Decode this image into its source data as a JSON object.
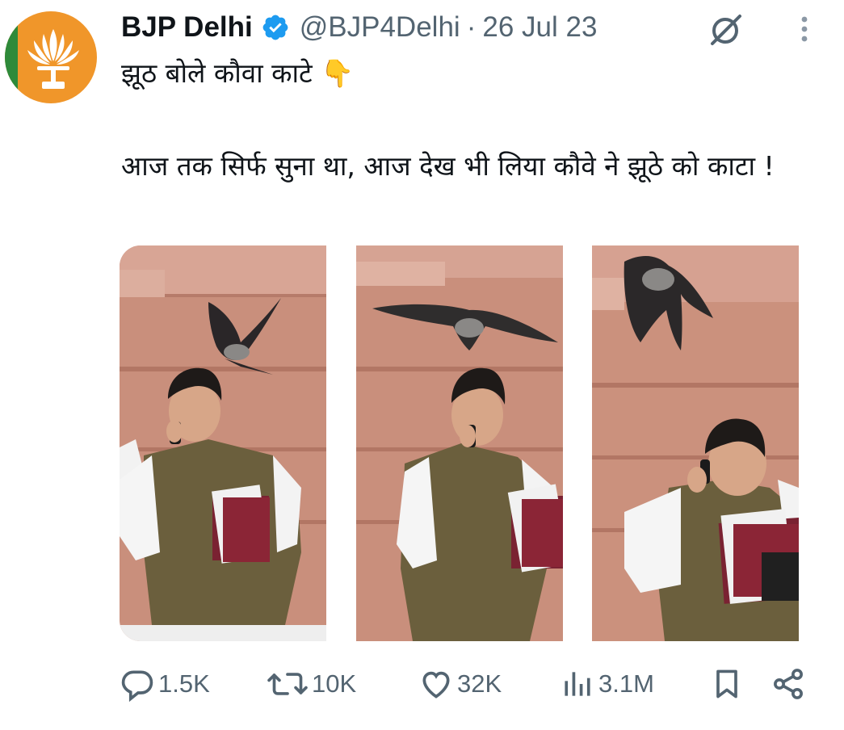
{
  "tweet": {
    "display_name": "BJP Delhi",
    "handle": "@BJP4Delhi",
    "separator": "·",
    "date": "26 Jul 23",
    "text_line1": "झूठ बोले कौवा काटे 👇",
    "text_line2": "आज तक सिर्फ सुना था, आज देख भी लिया कौवे ने झूठे को काटा !"
  },
  "stats": {
    "replies": "1.5K",
    "reposts": "10K",
    "likes": "32K",
    "views": "3.1M"
  },
  "colors": {
    "text": "#0f1419",
    "secondary": "#536471",
    "verified": "#1d9bf0",
    "avatar_bg": "#f0962a"
  },
  "icons": [
    "verified-badge-icon",
    "grok-icon",
    "more-icon",
    "reply-icon",
    "repost-icon",
    "like-icon",
    "views-icon",
    "bookmark-icon",
    "share-icon"
  ]
}
